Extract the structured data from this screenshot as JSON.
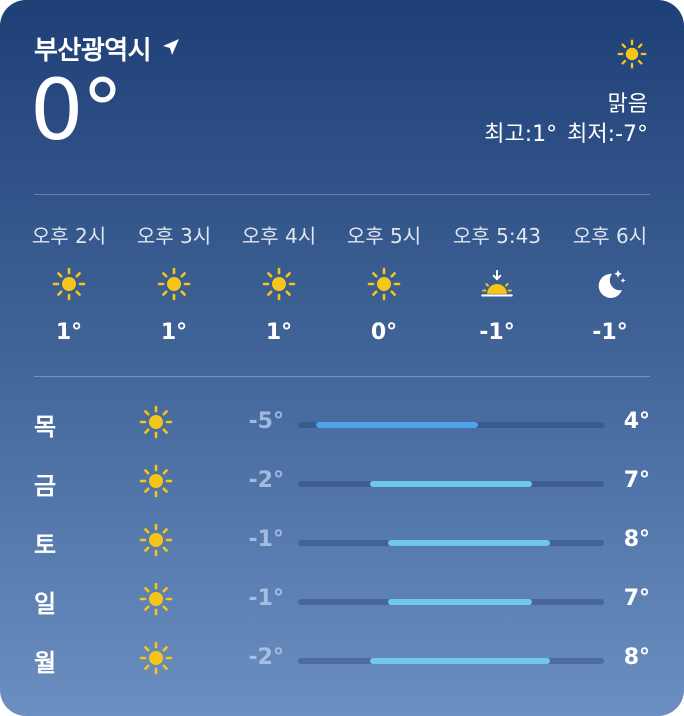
{
  "location": {
    "name": "부산광역시",
    "icon": "location-arrow-icon"
  },
  "current": {
    "temperature": "0°",
    "condition": "맑음",
    "condition_icon": "sun-icon",
    "high": "최고:1°",
    "low": "최저:-7°"
  },
  "colors": {
    "sun": "#f5c518",
    "bar_blue": "#4fa3e8",
    "bar_cyan": "#6ec8e6"
  },
  "hourly": [
    {
      "label": "오후 2시",
      "icon": "sun-icon",
      "temp": "1°"
    },
    {
      "label": "오후 3시",
      "icon": "sun-icon",
      "temp": "1°"
    },
    {
      "label": "오후 4시",
      "icon": "sun-icon",
      "temp": "1°"
    },
    {
      "label": "오후 5시",
      "icon": "sun-icon",
      "temp": "0°"
    },
    {
      "label": "오후 5:43",
      "icon": "sunset-icon",
      "temp": "-1°"
    },
    {
      "label": "오후 6시",
      "icon": "moon-stars-icon",
      "temp": "-1°"
    }
  ],
  "daily": [
    {
      "day": "목",
      "icon": "sun-icon",
      "low": "-5°",
      "high": "4°",
      "low_value": -5,
      "high_value": 4
    },
    {
      "day": "금",
      "icon": "sun-icon",
      "low": "-2°",
      "high": "7°",
      "low_value": -2,
      "high_value": 7
    },
    {
      "day": "토",
      "icon": "sun-icon",
      "low": "-1°",
      "high": "8°",
      "low_value": -1,
      "high_value": 8
    },
    {
      "day": "일",
      "icon": "sun-icon",
      "low": "-1°",
      "high": "7°",
      "low_value": -1,
      "high_value": 7
    },
    {
      "day": "월",
      "icon": "sun-icon",
      "low": "-2°",
      "high": "8°",
      "low_value": -2,
      "high_value": 8
    }
  ]
}
